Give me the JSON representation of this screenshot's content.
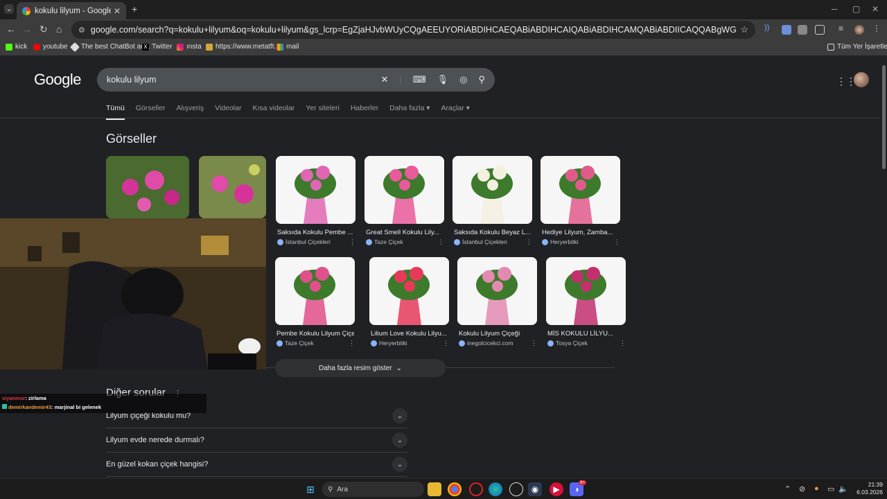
{
  "browser": {
    "tab_title": "kokulu lilyum - Google'da Ara",
    "url": "google.com/search?q=kokulu+lilyum&oq=kokulu+lilyum&gs_lcrp=EgZjaHJvbWUyCQgAEEUYORiABDIHCAEQABiABDIHCAIQABiABDIHCAMQABiABDIICAQQABgWGB4yCAgFEAAYFhgeMggIBhAAGBYYHjIICAcQABgWGB4yCAgI...",
    "bookmarks": [
      "kick",
      "youtube",
      "The best ChatBot an...",
      "Twitter",
      "ınsta",
      "https://www.metatft...",
      "mail"
    ],
    "all_bookmarks": "Tüm Yer İşaretleri"
  },
  "google": {
    "logo": "Google",
    "query": "kokulu lilyum",
    "tabs": [
      "Tümü",
      "Görseller",
      "Alışveriş",
      "Videolar",
      "Kısa videolar",
      "Yer siteleri",
      "Haberler",
      "Daha fazla ▾",
      "Araçlar ▾"
    ],
    "images_title": "Görseller",
    "images_row1": [
      {
        "caption": "Saksıda Kokulu Pembe ...",
        "source": "İstanbul Çiçekleri",
        "color": "#e066b4"
      },
      {
        "caption": "Great Smell Kokulu Lily...",
        "source": "Taze Çiçek",
        "color": "#e85a9a"
      },
      {
        "caption": "Saksıda Kokulu Beyaz L...",
        "source": "İstanbul Çiçekleri",
        "color": "#f3f0e0"
      },
      {
        "caption": "Hediye Lilyum, Zamba...",
        "source": "Heryerbitki",
        "color": "#e05a8c"
      }
    ],
    "images_row2": [
      {
        "caption": "Pembe Kokulu Lilyum Çiçeği",
        "source": "Taze Çiçek",
        "color": "#e0508a"
      },
      {
        "caption": "Lilium Love Kokulu Lilyu...",
        "source": "Heryerbitki",
        "color": "#e63a5a"
      },
      {
        "caption": "Kokulu Lilyum Çiçeği",
        "source": "inegolcicekci.com",
        "color": "#e38ab0"
      },
      {
        "caption": "MİS KOKULU LİLYU...",
        "source": "Tosya Çiçek",
        "color": "#c2306e"
      }
    ],
    "more_images": "Daha fazla resim göster",
    "questions_title": "Diğer sorular",
    "questions": [
      "Lilyum çiçeği kokulu mu?",
      "Lilyum evde nerede durmalı?",
      "En güzel kokan çiçek hangisi?"
    ]
  },
  "chat": [
    {
      "user": "siyanmur",
      "msg": ": zirlama",
      "color": "#e0344a"
    },
    {
      "user": "demirkandemir43",
      "msg": ": marjinal bi gelenek",
      "color": "#e8a040"
    }
  ],
  "taskbar": {
    "search_placeholder": "Ara",
    "time": "21:39",
    "date": "6.03.2026",
    "badge": "9+"
  }
}
